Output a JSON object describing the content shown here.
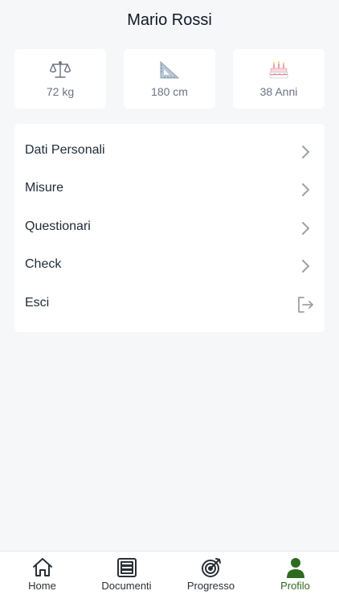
{
  "profile": {
    "name": "Mario Rossi"
  },
  "stats": [
    {
      "icon": "scale-icon",
      "value": "72 kg"
    },
    {
      "icon": "triangle-ruler-icon",
      "value": "180 cm"
    },
    {
      "icon": "birthday-cake-icon",
      "value": "38 Anni"
    }
  ],
  "menu": [
    {
      "label": "Dati Personali",
      "icon": "chevron-right-icon"
    },
    {
      "label": "Misure",
      "icon": "chevron-right-icon"
    },
    {
      "label": "Questionari",
      "icon": "chevron-right-icon"
    },
    {
      "label": "Check",
      "icon": "chevron-right-icon"
    },
    {
      "label": "Esci",
      "icon": "logout-icon"
    }
  ],
  "tabs": [
    {
      "label": "Home",
      "icon": "home-icon",
      "active": false
    },
    {
      "label": "Documenti",
      "icon": "document-list-icon",
      "active": false
    },
    {
      "label": "Progresso",
      "icon": "target-icon",
      "active": false
    },
    {
      "label": "Profilo",
      "icon": "user-icon",
      "active": true
    }
  ],
  "colors": {
    "background": "#f6f7f9",
    "card": "#ffffff",
    "active_tab": "#2f6b1f",
    "chevron": "#9aa0a8"
  }
}
